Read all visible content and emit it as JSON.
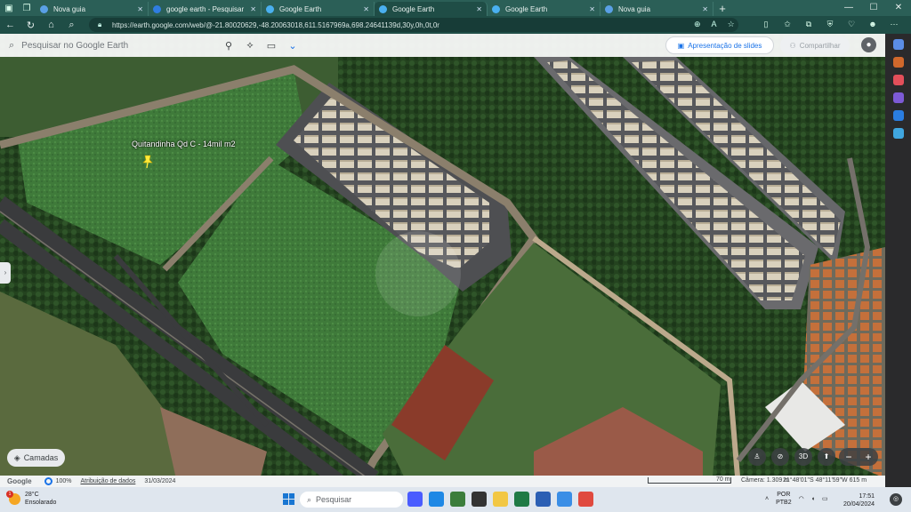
{
  "tabs": [
    {
      "label": "Nova guia",
      "favicon_color": "#5aa0e6"
    },
    {
      "label": "google earth - Pesquisar",
      "favicon_color": "#2f7de1"
    },
    {
      "label": "Google Earth",
      "favicon_color": "#4ab0f0"
    },
    {
      "label": "Google Earth",
      "favicon_color": "#4ab0f0",
      "active": true
    },
    {
      "label": "Google Earth",
      "favicon_color": "#4ab0f0"
    },
    {
      "label": "Nova guia",
      "favicon_color": "#5aa0e6"
    }
  ],
  "address": {
    "url": "https://earth.google.com/web/@-21.80020629,-48.20063018,611.5167969a,698.24641139d,30y,0h,0t,0r"
  },
  "earth": {
    "search_placeholder": "Pesquisar no Google Earth",
    "slides_label": "Apresentação de slides",
    "share_label": "Compartilhar",
    "layers_label": "Camadas",
    "placemark_label": "Quitandinha Qd C - 14mil m2",
    "view_3d_label": "3D"
  },
  "status": {
    "logo": "Google",
    "load_pct": "100%",
    "attribution": "Atribuição de dados",
    "date": "31/03/2024",
    "scale": "70 m",
    "camera": "Câmera: 1.309 m",
    "coords": "21°48'01\"S 48°11'59\"W  615 m"
  },
  "taskbar": {
    "temp": "28°C",
    "weather": "Ensolarado",
    "weather_badge": "1",
    "search_label": "Pesquisar",
    "lang_1": "POR",
    "lang_2": "PTB2",
    "time": "17:51",
    "date": "20/04/2024"
  },
  "colors": {
    "tab_bar": "#2b5f57",
    "accent": "#1a73e8"
  }
}
